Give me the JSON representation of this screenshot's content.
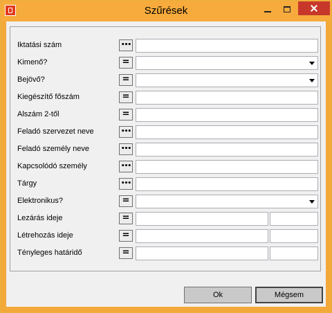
{
  "window": {
    "title": "Szűrések"
  },
  "filters": [
    {
      "label": "Iktatási szám",
      "op": "•••",
      "type": "text"
    },
    {
      "label": "Kimenő?",
      "op": "=",
      "type": "combo"
    },
    {
      "label": "Bejövő?",
      "op": "=",
      "type": "combo"
    },
    {
      "label": "Kiegészítő főszám",
      "op": "=",
      "type": "text"
    },
    {
      "label": "Alszám 2-től",
      "op": "=",
      "type": "text"
    },
    {
      "label": "Feladó szervezet neve",
      "op": "•••",
      "type": "text"
    },
    {
      "label": "Feladó személy neve",
      "op": "•••",
      "type": "text"
    },
    {
      "label": "Kapcsolódó személy",
      "op": "•••",
      "type": "text"
    },
    {
      "label": "Tárgy",
      "op": "•••",
      "type": "text"
    },
    {
      "label": "Elektronikus?",
      "op": "=",
      "type": "combo"
    },
    {
      "label": "Lezárás ideje",
      "op": "=",
      "type": "split"
    },
    {
      "label": "Létrehozás ideje",
      "op": "=",
      "type": "split"
    },
    {
      "label": "Tényleges határidő",
      "op": "=",
      "type": "split"
    }
  ],
  "buttons": {
    "ok": "Ok",
    "cancel": "Mégsem"
  }
}
